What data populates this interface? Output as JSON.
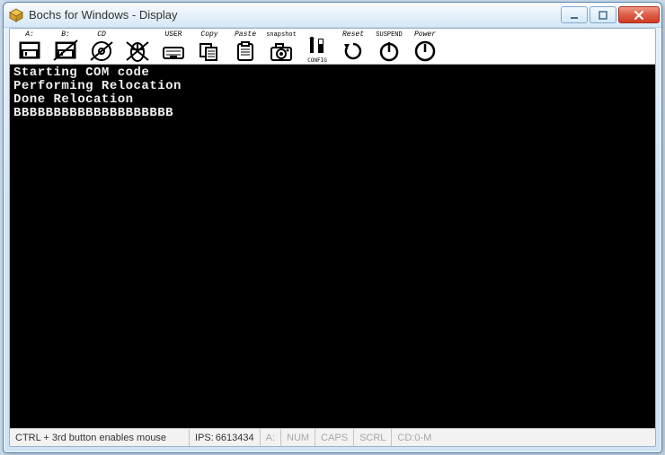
{
  "window": {
    "title": "Bochs for Windows - Display"
  },
  "toolbar": {
    "items": [
      {
        "label": "A:"
      },
      {
        "label": "B:"
      },
      {
        "label": "CD"
      },
      {
        "label": ""
      },
      {
        "label": "USER"
      },
      {
        "label": "Copy"
      },
      {
        "label": "Paste"
      },
      {
        "label": "snapshot"
      },
      {
        "label": ""
      },
      {
        "label": "Reset"
      },
      {
        "label": "SUSPEND"
      },
      {
        "label": "Power"
      }
    ]
  },
  "terminal": {
    "lines": [
      "Starting COM code",
      "Performing Relocation",
      "Done Relocation",
      "BBBBBBBBBBBBBBBBBBBB"
    ]
  },
  "status": {
    "mouse": "CTRL + 3rd button enables mouse",
    "ips_label": "IPS:",
    "ips_value": "6613434",
    "drive_a": "A:",
    "num": "NUM",
    "caps": "CAPS",
    "scrl": "SCRL",
    "cd": "CD:0-M"
  }
}
